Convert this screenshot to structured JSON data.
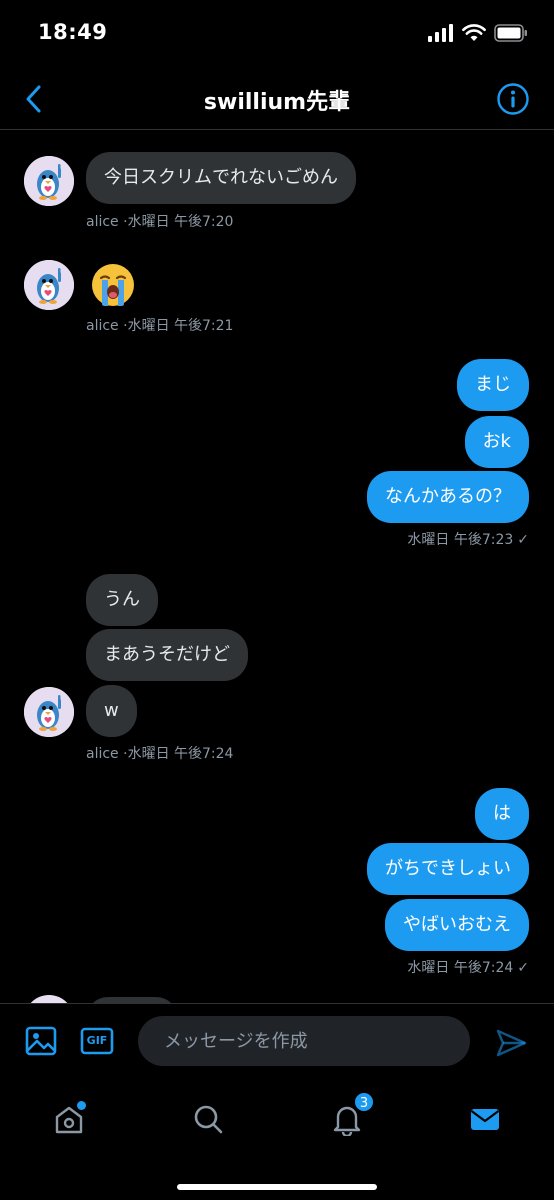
{
  "status_bar": {
    "time": "18:49"
  },
  "header": {
    "title": "swillium先輩"
  },
  "messages": {
    "m1": {
      "text": "今日スクリムでれないごめん",
      "meta": "alice ·水曜日 午後7:20"
    },
    "m2": {
      "emoji_name": "loudly-crying-face-emoji",
      "meta": "alice ·水曜日 午後7:21"
    },
    "g3": {
      "bubbles": [
        "まじ",
        "おk",
        "なんかあるの？"
      ],
      "meta": "水曜日 午後7:23",
      "status": "✓"
    },
    "g4": {
      "bubbles": [
        "うん",
        "まあうそだけど",
        "w"
      ],
      "meta": "alice ·水曜日 午後7:24"
    },
    "g5": {
      "bubbles": [
        "は",
        "がちできしょい",
        "やばいおむえ"
      ],
      "meta": "水曜日 午後7:24",
      "status": "✓"
    }
  },
  "composer": {
    "placeholder": "メッセージを作成",
    "image_icon": "image-icon",
    "gif_label": "GIF",
    "send_icon": "send-icon"
  },
  "tabbar": {
    "tabs": [
      "home-icon",
      "search-icon",
      "bell-icon",
      "mail-icon"
    ],
    "notifications_count": "3"
  },
  "colors": {
    "accent": "#1d9bf0",
    "bubble_in": "#2f3336",
    "background": "#000000",
    "meta": "#8b98a5"
  }
}
